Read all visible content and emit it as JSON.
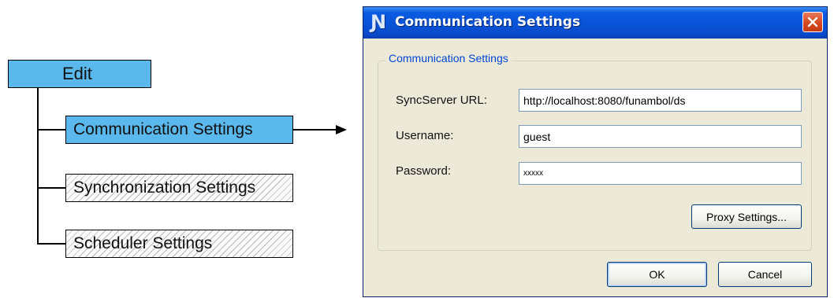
{
  "tree": {
    "root_label": "Edit",
    "items": [
      {
        "label": "Communication Settings",
        "state": "active"
      },
      {
        "label": "Synchronization Settings",
        "state": "disabled"
      },
      {
        "label": "Scheduler Settings",
        "state": "disabled"
      }
    ]
  },
  "dialog": {
    "title": "Communication Settings",
    "group_title": "Communication Settings",
    "fields": {
      "url": {
        "label": "SyncServer URL:",
        "value": "http://localhost:8080/funambol/ds"
      },
      "username": {
        "label": "Username:",
        "value": "guest"
      },
      "password": {
        "label": "Password:",
        "value": "xxxxx"
      }
    },
    "proxy_button": "Proxy Settings...",
    "ok_button": "OK",
    "cancel_button": "Cancel"
  },
  "colors": {
    "active_box": "#5bb8ec",
    "titlebar": "#0a4bcc",
    "close_button": "#d8481f",
    "group_title": "#0046d5",
    "dialog_bg": "#ece9d8"
  },
  "icons": [
    "app-logo-icon",
    "close-x-icon",
    "arrow-right-icon"
  ]
}
